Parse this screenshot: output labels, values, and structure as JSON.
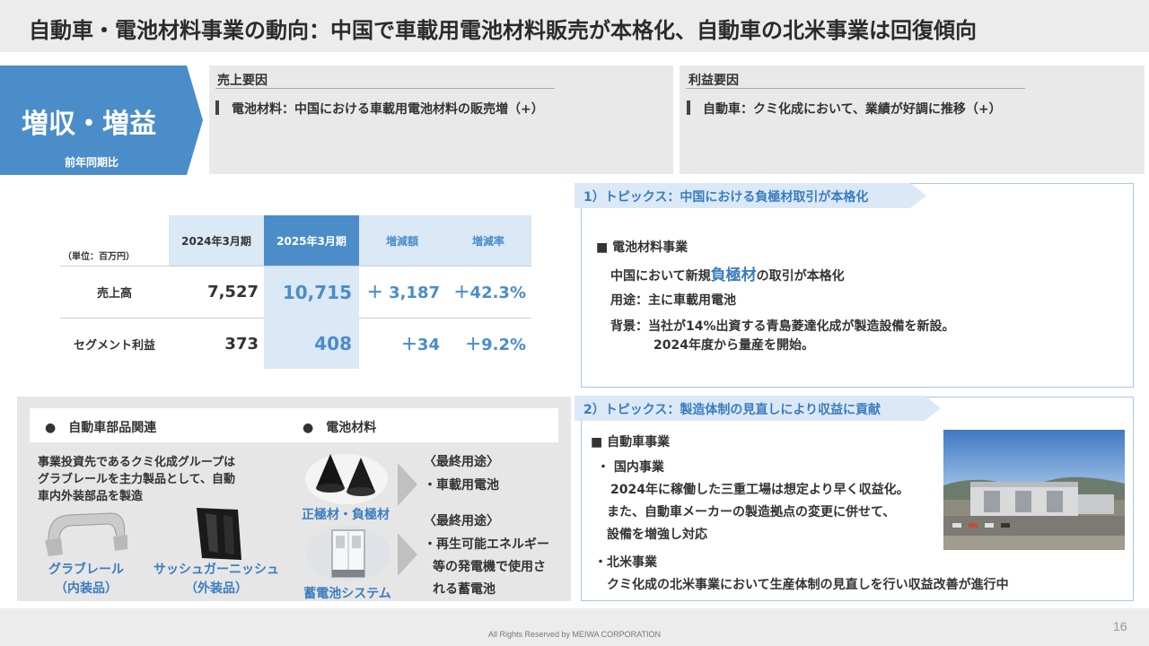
{
  "header": {
    "title": "自動車・電池材料事業の動向：中国で車載用電池材料販売が本格化、自動車の北米事業は回復傾向"
  },
  "badge": {
    "main": "増収・増益",
    "sub": "前年同期比"
  },
  "factors": {
    "sales": {
      "heading": "売上要因",
      "item": "電池材料：中国における車載用電池材料の販売増（+）"
    },
    "profit": {
      "heading": "利益要因",
      "item": "自動車：クミ化成において、業績が好調に推移（+）"
    }
  },
  "table": {
    "unit": "（単位：百万円）",
    "headers": [
      "2024年3月期",
      "2025年3月期",
      "増減額",
      "増減率"
    ],
    "rows": [
      {
        "label": "売上高",
        "prev": "7,527",
        "curr": "10,715",
        "diff": "＋ 3,187",
        "rate": "＋42.3%"
      },
      {
        "label": "セグメント利益",
        "prev": "373",
        "curr": "408",
        "diff": "＋34",
        "rate": "＋9.2%"
      }
    ]
  },
  "topic1": {
    "tag": "1）トピックス：中国における負極材取引が本格化",
    "section": "■ 電池材料事業",
    "line1_pre": "中国において新規",
    "line1_accent": "負極材",
    "line1_post": "の取引が本格化",
    "line2": "用途：主に車載用電池",
    "line3": "背景：当社が14%出資する青島菱達化成が製造設備を新設。",
    "line4": "2024年度から量産を開始。"
  },
  "topic2": {
    "tag": "2）トピックス：製造体制の見直しにより収益に貢献",
    "section": "■ 自動車事業",
    "domestic_head": "・ 国内事業",
    "domestic_1": "2024年に稼働した三重工場は想定より早く収益化。",
    "domestic_2": "また、自動車メーカーの製造拠点の変更に併せて、",
    "domestic_3": "設備を増強し対応",
    "na_head": "・北米事業",
    "na_1": "クミ化成の北米事業において生産体制の見直しを行い収益改善が進行中"
  },
  "products": {
    "auto_head": "●　自動車部品関連",
    "battery_head": "●　電池材料",
    "desc_1": "事業投資先であるクミ化成グループは",
    "desc_2": "グラブレールを主力製品として、自動",
    "desc_3": "車内外装部品を製造",
    "grab_name": "グラブレール",
    "grab_sub": "（内装品）",
    "sash_name": "サッシュガーニッシュ",
    "sash_sub": "（外装品）",
    "electrode": "正極材・負極材",
    "storage": "蓄電池システム",
    "use1_head": "〈最終用途〉",
    "use1_item": "・車載用電池",
    "use2_head": "〈最終用途〉",
    "use2_1": "・再生可能エネルギー",
    "use2_2": "等の発電機で使用さ",
    "use2_3": "れる蓄電池"
  },
  "footer": {
    "copyright": "All Rights Reserved by MEIWA CORPORATION",
    "page": "16"
  },
  "colors": {
    "accent_blue": "#4b8dc9",
    "pale_blue": "#dbe8f5",
    "panel_border": "#a9c7e6"
  }
}
